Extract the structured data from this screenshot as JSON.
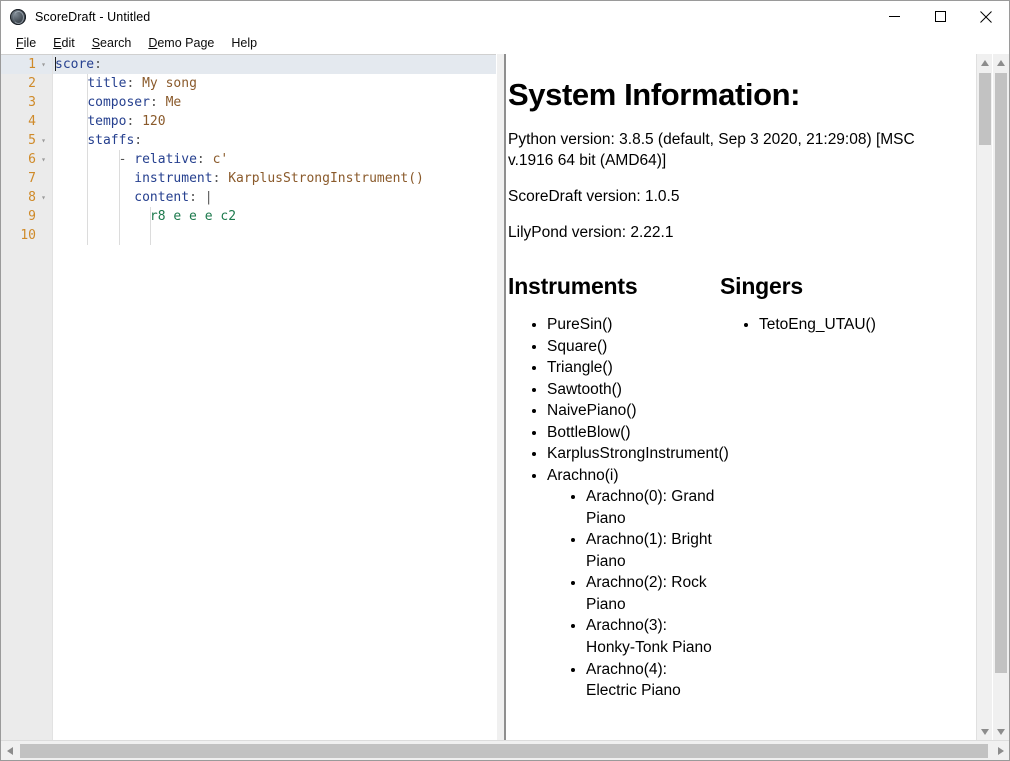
{
  "window": {
    "title": "ScoreDraft - Untitled",
    "app_icon": "scoredraft-globe-icon",
    "minimize_label": "Minimize",
    "maximize_label": "Maximize",
    "close_label": "Close"
  },
  "menubar": {
    "items": [
      {
        "label": "File",
        "accel": "F"
      },
      {
        "label": "Edit",
        "accel": "E"
      },
      {
        "label": "Search",
        "accel": "S"
      },
      {
        "label": "Demo Page",
        "accel": "D"
      },
      {
        "label": "Help",
        "accel": ""
      }
    ]
  },
  "editor": {
    "active_line": 1,
    "gutter": [
      {
        "num": "1",
        "fold": "▾"
      },
      {
        "num": "2",
        "fold": ""
      },
      {
        "num": "3",
        "fold": ""
      },
      {
        "num": "4",
        "fold": ""
      },
      {
        "num": "5",
        "fold": "▾"
      },
      {
        "num": "6",
        "fold": "▾"
      },
      {
        "num": "7",
        "fold": ""
      },
      {
        "num": "8",
        "fold": "▾"
      },
      {
        "num": "9",
        "fold": ""
      },
      {
        "num": "10",
        "fold": ""
      }
    ],
    "lines": [
      "score:",
      "    title: My song",
      "    composer: Me",
      "    tempo: 120",
      "    staffs:",
      "        - relative: c'",
      "          instrument: KarplusStrongInstrument()",
      "          content: |",
      "            r8 e e e c2",
      ""
    ],
    "colors": {
      "key": "#26408f",
      "value": "#8a5a2b",
      "string": "#1d7a4d",
      "line_number": "#cf8a29",
      "active_line_bg": "#e4e9ef",
      "gutter_bg": "#ebebeb"
    }
  },
  "info": {
    "heading": "System Information:",
    "paragraphs": [
      "Python version: 3.8.5 (default, Sep 3 2020, 21:29:08) [MSC v.1916 64 bit (AMD64)]",
      "ScoreDraft version: 1.0.5",
      "LilyPond version: 2.22.1"
    ],
    "instruments": {
      "heading": "Instruments",
      "items": [
        "PureSin()",
        "Square()",
        "Triangle()",
        "Sawtooth()",
        "NaivePiano()",
        "BottleBlow()",
        "KarplusStrongInstrument()",
        "Arachno(i)"
      ],
      "sub_items": [
        "Arachno(0): Grand Piano",
        "Arachno(1): Bright Piano",
        "Arachno(2): Rock Piano",
        "Arachno(3): Honky-Tonk Piano",
        "Arachno(4): Electric Piano"
      ]
    },
    "singers": {
      "heading": "Singers",
      "items": [
        "TetoEng_UTAU()"
      ]
    }
  },
  "scrollbars": {
    "inner_vertical": {
      "up": "▴",
      "down": "▾"
    },
    "outer_vertical": {
      "up": "▴",
      "down": "▾"
    },
    "horizontal": {
      "left": "◂",
      "right": "▸"
    }
  }
}
